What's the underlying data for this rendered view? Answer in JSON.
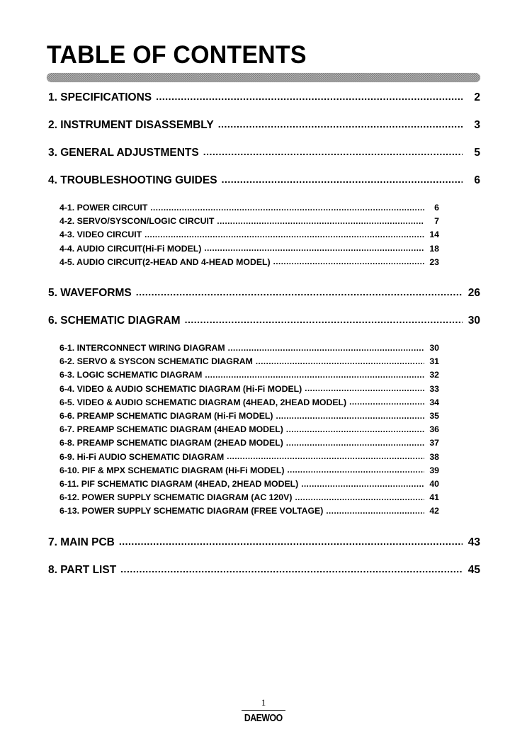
{
  "document": {
    "title": "TABLE OF CONTENTS",
    "brand": "DAEWOO",
    "footer_page_number": "1"
  },
  "toc": {
    "entries": [
      {
        "level": 1,
        "label": "1. SPECIFICATIONS",
        "page": "2"
      },
      {
        "level": 1,
        "label": "2. INSTRUMENT DISASSEMBLY",
        "page": "3"
      },
      {
        "level": 1,
        "label": "3. GENERAL  ADJUSTMENTS",
        "page": "5"
      },
      {
        "level": 1,
        "label": "4. TROUBLESHOOTING GUIDES",
        "page": "6"
      },
      {
        "level": 2,
        "label": "4-1. POWER CIRCUIT",
        "page": "6"
      },
      {
        "level": 2,
        "label": "4-2. SERVO/SYSCON/LOGIC CIRCUIT",
        "page": "7"
      },
      {
        "level": 2,
        "label": "4-3. VIDEO CIRCUIT",
        "page": "14"
      },
      {
        "level": 2,
        "label": "4-4. AUDIO CIRCUIT(Hi-Fi MODEL)",
        "page": "18"
      },
      {
        "level": 2,
        "label": "4-5. AUDIO CIRCUIT(2-HEAD AND 4-HEAD MODEL)",
        "page": "23"
      },
      {
        "level": 1,
        "label": "5. WAVEFORMS",
        "page": "26"
      },
      {
        "level": 1,
        "label": "6. SCHEMATIC DIAGRAM",
        "page": "30"
      },
      {
        "level": 2,
        "label": "6-1. INTERCONNECT WIRING DIAGRAM",
        "page": "30"
      },
      {
        "level": 2,
        "label": "6-2. SERVO & SYSCON SCHEMATIC DIAGRAM",
        "page": "31"
      },
      {
        "level": 2,
        "label": "6-3. LOGIC SCHEMATIC DIAGRAM",
        "page": "32"
      },
      {
        "level": 2,
        "label": "6-4. VIDEO & AUDIO SCHEMATIC DIAGRAM (Hi-Fi MODEL)",
        "page": "33"
      },
      {
        "level": 2,
        "label": "6-5. VIDEO & AUDIO SCHEMATIC DIAGRAM (4HEAD, 2HEAD MODEL)",
        "page": "34"
      },
      {
        "level": 2,
        "label": "6-6. PREAMP SCHEMATIC DIAGRAM (Hi-Fi MODEL)",
        "page": "35"
      },
      {
        "level": 2,
        "label": "6-7. PREAMP SCHEMATIC DIAGRAM (4HEAD MODEL)",
        "page": "36"
      },
      {
        "level": 2,
        "label": "6-8. PREAMP SCHEMATIC DIAGRAM (2HEAD MODEL)",
        "page": "37"
      },
      {
        "level": 2,
        "label": "6-9. Hi-Fi AUDIO SCHEMATIC DIAGRAM",
        "page": "38"
      },
      {
        "level": 2,
        "label": "6-10. PIF & MPX SCHEMATIC DIAGRAM (Hi-Fi MODEL)",
        "page": "39"
      },
      {
        "level": 2,
        "label": "6-11. PIF SCHEMATIC DIAGRAM (4HEAD, 2HEAD MODEL)",
        "page": "40"
      },
      {
        "level": 2,
        "label": "6-12. POWER SUPPLY SCHEMATIC DIAGRAM (AC 120V)",
        "page": "41"
      },
      {
        "level": 2,
        "label": "6-13. POWER SUPPLY SCHEMATIC DIAGRAM (FREE VOLTAGE)",
        "page": "42"
      },
      {
        "level": 1,
        "label": "7. MAIN PCB",
        "page": "43"
      },
      {
        "level": 1,
        "label": "8. PART LIST",
        "page": "45"
      }
    ]
  },
  "colors": {
    "text": "#000000",
    "rule_gray": "#7d7d7d",
    "background": "#ffffff"
  }
}
